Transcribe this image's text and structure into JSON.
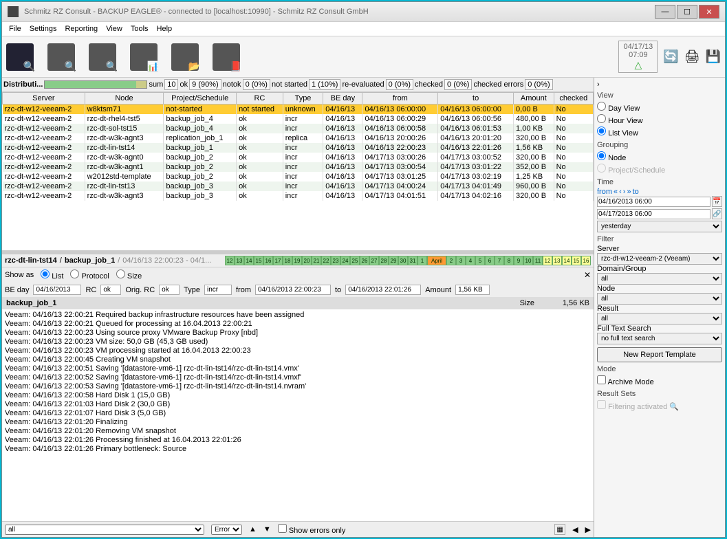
{
  "window": {
    "title": "Schmitz RZ Consult - BACKUP EAGLE® - connected to [localhost:10990] - Schmitz RZ Consult GmbH"
  },
  "menu": [
    "File",
    "Settings",
    "Reporting",
    "View",
    "Tools",
    "Help"
  ],
  "timestamp": {
    "date": "04/17/13",
    "time": "07:09"
  },
  "stats": {
    "label": "Distributi...",
    "sum_label": "sum",
    "sum": "10",
    "ok_label": "ok",
    "ok": "9 (90%)",
    "notok_label": "notok",
    "notok": "0 (0%)",
    "notstarted_label": "not started",
    "notstarted": "1 (10%)",
    "reeval_label": "re-evaluated",
    "reeval": "0 (0%)",
    "checked_label": "checked",
    "checked": "0 (0%)",
    "cerrors_label": "checked errors",
    "cerrors": "0 (0%)"
  },
  "columns": [
    "Server",
    "Node",
    "Project/Schedule",
    "RC",
    "Type",
    "BE day",
    "from",
    "to",
    "Amount",
    "checked"
  ],
  "rows": [
    {
      "hl": true,
      "c": [
        "rzc-dt-w12-veeam-2",
        "w8ktsm71",
        "not-started",
        "not started",
        "unknown",
        "04/16/13",
        "04/16/13 06:00:00",
        "04/16/13 06:00:00",
        "0,00 B",
        "No"
      ]
    },
    {
      "c": [
        "rzc-dt-w12-veeam-2",
        "rzc-dt-rhel4-tst5",
        "backup_job_4",
        "ok",
        "incr",
        "04/16/13",
        "04/16/13 06:00:29",
        "04/16/13 06:00:56",
        "480,00 B",
        "No"
      ]
    },
    {
      "c": [
        "rzc-dt-w12-veeam-2",
        "rzc-dt-sol-tst15",
        "backup_job_4",
        "ok",
        "incr",
        "04/16/13",
        "04/16/13 06:00:58",
        "04/16/13 06:01:53",
        "1,00 KB",
        "No"
      ]
    },
    {
      "c": [
        "rzc-dt-w12-veeam-2",
        "rzc-dt-w3k-agnt3",
        "replication_job_1",
        "ok",
        "replica",
        "04/16/13",
        "04/16/13 20:00:26",
        "04/16/13 20:01:20",
        "320,00 B",
        "No"
      ]
    },
    {
      "c": [
        "rzc-dt-w12-veeam-2",
        "rzc-dt-lin-tst14",
        "backup_job_1",
        "ok",
        "incr",
        "04/16/13",
        "04/16/13 22:00:23",
        "04/16/13 22:01:26",
        "1,56 KB",
        "No"
      ]
    },
    {
      "c": [
        "rzc-dt-w12-veeam-2",
        "rzc-dt-w3k-agnt0",
        "backup_job_2",
        "ok",
        "incr",
        "04/16/13",
        "04/17/13 03:00:26",
        "04/17/13 03:00:52",
        "320,00 B",
        "No"
      ]
    },
    {
      "c": [
        "rzc-dt-w12-veeam-2",
        "rzc-dt-w3k-agnt1",
        "backup_job_2",
        "ok",
        "incr",
        "04/16/13",
        "04/17/13 03:00:54",
        "04/17/13 03:01:22",
        "352,00 B",
        "No"
      ]
    },
    {
      "c": [
        "rzc-dt-w12-veeam-2",
        "w2012std-template",
        "backup_job_2",
        "ok",
        "incr",
        "04/16/13",
        "04/17/13 03:01:25",
        "04/17/13 03:02:19",
        "1,25 KB",
        "No"
      ]
    },
    {
      "c": [
        "rzc-dt-w12-veeam-2",
        "rzc-dt-lin-tst13",
        "backup_job_3",
        "ok",
        "incr",
        "04/16/13",
        "04/17/13 04:00:24",
        "04/17/13 04:01:49",
        "960,00 B",
        "No"
      ]
    },
    {
      "c": [
        "rzc-dt-w12-veeam-2",
        "rzc-dt-w3k-agnt3",
        "backup_job_3",
        "ok",
        "incr",
        "04/16/13",
        "04/17/13 04:01:51",
        "04/17/13 04:02:16",
        "320,00 B",
        "No"
      ]
    }
  ],
  "detail": {
    "node": "rzc-dt-lin-tst14",
    "sep1": " / ",
    "job": "backup_job_1",
    "sep2": " / ",
    "range": "04/16/13 22:00:23 - 04/1...",
    "cal_days": [
      "12",
      "13",
      "14",
      "15",
      "16",
      "17",
      "18",
      "19",
      "20",
      "21",
      "22",
      "23",
      "24",
      "25",
      "26",
      "27",
      "28",
      "29",
      "30",
      "31",
      "1",
      "April",
      "2",
      "3",
      "4",
      "5",
      "6",
      "7",
      "8",
      "9",
      "10",
      "11",
      "12",
      "13",
      "14",
      "15",
      "16"
    ],
    "showas_label": "Show as",
    "showas_opts": [
      "List",
      "Protocol",
      "Size"
    ],
    "beday_label": "BE day",
    "beday": "04/16/2013",
    "rc_label": "RC",
    "rc": "ok",
    "origrc_label": "Orig. RC",
    "origrc": "ok",
    "type_label": "Type",
    "type": "incr",
    "from_label": "from",
    "from": "04/16/2013 22:00:23",
    "to_label": "to",
    "to": "04/16/2013 22:01:26",
    "amount_label": "Amount",
    "amount": "1,56 KB",
    "job_title": "backup_job_1",
    "size_label": "Size",
    "size": "1,56 KB"
  },
  "log": [
    "Veeam: 04/16/13 22:00:21 Required backup infrastructure resources have been assigned",
    "Veeam: 04/16/13 22:00:21 Queued for processing at 16.04.2013 22:00:21",
    "Veeam: 04/16/13 22:00:23 Using source proxy VMware Backup Proxy [nbd]",
    "Veeam: 04/16/13 22:00:23 VM size: 50,0 GB (45,3 GB used)",
    "Veeam: 04/16/13 22:00:23 VM processing started at 16.04.2013 22:00:23",
    "Veeam: 04/16/13 22:00:45 Creating VM snapshot",
    "Veeam: 04/16/13 22:00:51 Saving '[datastore-vm6-1] rzc-dt-lin-tst14/rzc-dt-lin-tst14.vmx'",
    "Veeam: 04/16/13 22:00:52 Saving '[datastore-vm6-1] rzc-dt-lin-tst14/rzc-dt-lin-tst14.vmxf'",
    "Veeam: 04/16/13 22:00:53 Saving '[datastore-vm6-1] rzc-dt-lin-tst14/rzc-dt-lin-tst14.nvram'",
    "Veeam: 04/16/13 22:00:58 Hard Disk 1 (15,0 GB)",
    "Veeam: 04/16/13 22:01:03 Hard Disk 2 (30,0 GB)",
    "Veeam: 04/16/13 22:01:07 Hard Disk 3 (5,0 GB)",
    "Veeam: 04/16/13 22:01:20 Finalizing",
    "Veeam: 04/16/13 22:01:20 Removing VM snapshot",
    "Veeam: 04/16/13 22:01:26 Processing finished at 16.04.2013 22:01:26",
    "Veeam: 04/16/13 22:01:26 Primary bottleneck: Source"
  ],
  "bottom": {
    "filter1": "all",
    "error_label": "Error",
    "show_errors": "Show errors only"
  },
  "side": {
    "view_label": "View",
    "view_opts": [
      "Day View",
      "Hour View",
      "List View"
    ],
    "view_sel": "List View",
    "grouping_label": "Grouping",
    "grouping_opts": [
      "Node",
      "Project/Schedule"
    ],
    "grouping_sel": "Node",
    "time_label": "Time",
    "from_label": "from",
    "to_label": "to",
    "from": "04/16/2013 06:00",
    "to": "04/17/2013 06:00",
    "preset": "yesterday",
    "filter_label": "Filter",
    "server_label": "Server",
    "server": "rzc-dt-w12-veeam-2 (Veeam)",
    "domain_label": "Domain/Group",
    "domain": "all",
    "node_label": "Node",
    "node": "all",
    "result_label": "Result",
    "result": "all",
    "fts_label": "Full Text Search",
    "fts": "no full text search",
    "new_report": "New Report Template",
    "mode_label": "Mode",
    "archive": "Archive Mode",
    "resultsets_label": "Result Sets",
    "filtering": "Filtering activated"
  }
}
